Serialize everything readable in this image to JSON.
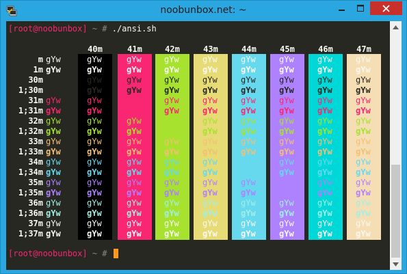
{
  "window": {
    "title": "noobunbox.net: ~"
  },
  "terminal": {
    "prompt_user": "[root@noobunbox]",
    "prompt_tail": " ~ # ",
    "command": "./ansi.sh",
    "sample_text": "gYw",
    "bg_headers": [
      "40m",
      "41m",
      "42m",
      "43m",
      "44m",
      "45m",
      "46m",
      "47m"
    ],
    "row_labels": [
      "m",
      "1m",
      "30m",
      "1;30m",
      "31m",
      "1;31m",
      "32m",
      "1;32m",
      "33m",
      "1;33m",
      "34m",
      "1;34m",
      "35m",
      "1;35m",
      "36m",
      "1;36m",
      "37m",
      "1;37m"
    ]
  },
  "colors": {
    "terminal_bg": "#272822",
    "default_fg": "#f8f8f2",
    "fg": [
      "#272822",
      "#f92672",
      "#a6e22e",
      "#f4bf75",
      "#66d9ef",
      "#ae81ff",
      "#a1efe4",
      "#f8f8f2"
    ],
    "bg": [
      "#000000",
      "#f92672",
      "#a6e22e",
      "#e6db74",
      "#66d9ef",
      "#ae81ff",
      "#00d7d7",
      "#f5deb3"
    ],
    "prompt_user": "#f92672",
    "cursor": "#fd971f",
    "titlebar": "#2aa7e0",
    "close_button": "#c7302b"
  }
}
